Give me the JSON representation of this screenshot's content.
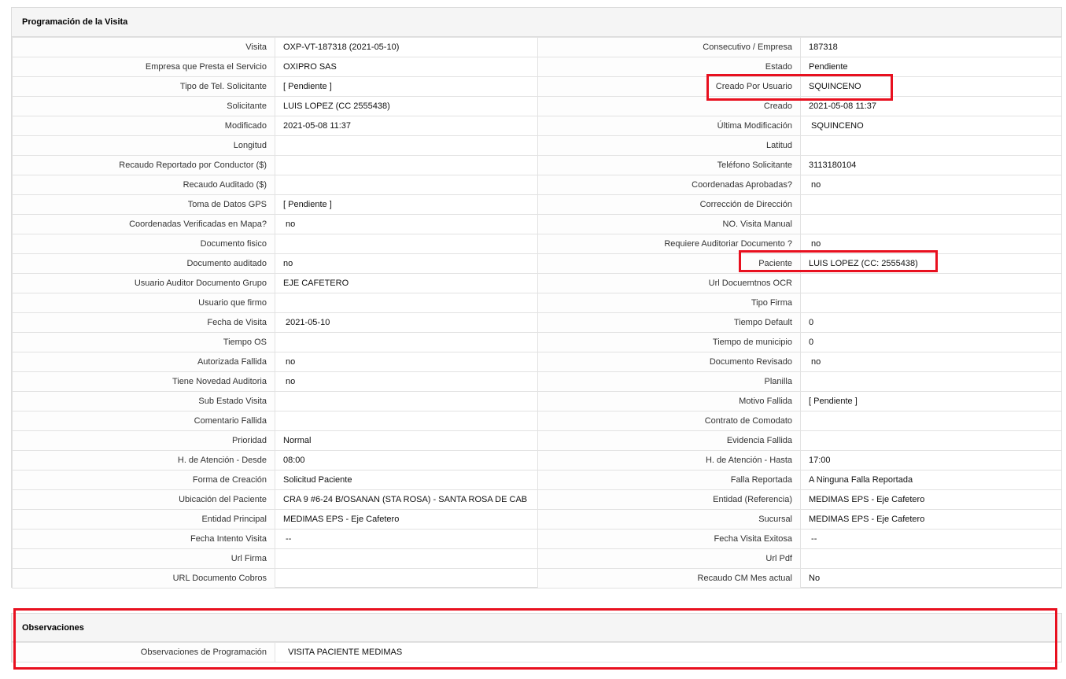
{
  "programacion": {
    "title": "Programación de la Visita",
    "rows": [
      [
        {
          "label": "Visita",
          "value": "OXP-VT-187318 (2021-05-10)"
        },
        {
          "label": "Consecutivo / Empresa",
          "value": "187318"
        }
      ],
      [
        {
          "label": "Empresa que Presta el Servicio",
          "value": "OXIPRO SAS"
        },
        {
          "label": "Estado",
          "value": "Pendiente"
        }
      ],
      [
        {
          "label": "Tipo de Tel. Solicitante",
          "value": "[ Pendiente ]"
        },
        {
          "label": "Creado Por Usuario",
          "value": "SQUINCENO"
        }
      ],
      [
        {
          "label": "Solicitante",
          "value": "LUIS LOPEZ (CC 2555438)"
        },
        {
          "label": "Creado",
          "value": "2021-05-08 11:37"
        }
      ],
      [
        {
          "label": "Modificado",
          "value": "2021-05-08 11:37"
        },
        {
          "label": "Última Modificación",
          "value": " SQUINCENO"
        }
      ],
      [
        {
          "label": "Longitud",
          "value": ""
        },
        {
          "label": "Latitud",
          "value": ""
        }
      ],
      [
        {
          "label": "Recaudo Reportado por Conductor ($)",
          "value": ""
        },
        {
          "label": "Teléfono Solicitante",
          "value": "3113180104"
        }
      ],
      [
        {
          "label": "Recaudo Auditado ($)",
          "value": ""
        },
        {
          "label": "Coordenadas Aprobadas?",
          "value": " no"
        }
      ],
      [
        {
          "label": "Toma de Datos GPS",
          "value": "[ Pendiente ]"
        },
        {
          "label": "Corrección de Dirección",
          "value": ""
        }
      ],
      [
        {
          "label": "Coordenadas Verificadas en Mapa?",
          "value": " no"
        },
        {
          "label": "NO. Visita Manual",
          "value": ""
        }
      ],
      [
        {
          "label": "Documento fisico",
          "value": ""
        },
        {
          "label": "Requiere Auditoriar Documento ?",
          "value": " no"
        }
      ],
      [
        {
          "label": "Documento auditado",
          "value": "no"
        },
        {
          "label": "Paciente",
          "value": "LUIS LOPEZ (CC: 2555438)"
        }
      ],
      [
        {
          "label": "Usuario Auditor Documento Grupo",
          "value": "EJE CAFETERO"
        },
        {
          "label": "Url Docuemtnos OCR",
          "value": ""
        }
      ],
      [
        {
          "label": "Usuario que firmo",
          "value": ""
        },
        {
          "label": "Tipo Firma",
          "value": ""
        }
      ],
      [
        {
          "label": "Fecha de Visita",
          "value": " 2021-05-10"
        },
        {
          "label": "Tiempo Default",
          "value": "0"
        }
      ],
      [
        {
          "label": "Tiempo OS",
          "value": ""
        },
        {
          "label": "Tiempo de municipio",
          "value": "0"
        }
      ],
      [
        {
          "label": "Autorizada Fallida",
          "value": " no"
        },
        {
          "label": "Documento Revisado",
          "value": " no"
        }
      ],
      [
        {
          "label": "Tiene Novedad Auditoria",
          "value": " no"
        },
        {
          "label": "Planilla",
          "value": ""
        }
      ],
      [
        {
          "label": "Sub Estado Visita",
          "value": ""
        },
        {
          "label": "Motivo Fallida",
          "value": "[ Pendiente ]"
        }
      ],
      [
        {
          "label": "Comentario Fallida",
          "value": ""
        },
        {
          "label": "Contrato de Comodato",
          "value": ""
        }
      ],
      [
        {
          "label": "Prioridad",
          "value": "Normal"
        },
        {
          "label": "Evidencia Fallida",
          "value": ""
        }
      ],
      [
        {
          "label": "H. de Atención - Desde",
          "value": "08:00"
        },
        {
          "label": "H. de Atención - Hasta",
          "value": "17:00"
        }
      ],
      [
        {
          "label": "Forma de Creación",
          "value": "Solicitud Paciente"
        },
        {
          "label": "Falla Reportada",
          "value": "A Ninguna Falla Reportada"
        }
      ],
      [
        {
          "label": "Ubicación del Paciente",
          "value": "CRA 9 #6-24 B/OSANAN (STA ROSA) - SANTA ROSA DE CAB"
        },
        {
          "label": "Entidad (Referencia)",
          "value": "MEDIMAS EPS - Eje Cafetero"
        }
      ],
      [
        {
          "label": "Entidad Principal",
          "value": "MEDIMAS EPS - Eje Cafetero"
        },
        {
          "label": "Sucursal",
          "value": "MEDIMAS EPS - Eje Cafetero"
        }
      ],
      [
        {
          "label": "Fecha Intento Visita",
          "value": " --"
        },
        {
          "label": "Fecha Visita Exitosa",
          "value": " --"
        }
      ],
      [
        {
          "label": "Url Firma",
          "value": ""
        },
        {
          "label": "Url Pdf",
          "value": ""
        }
      ],
      [
        {
          "label": "URL Documento Cobros",
          "value": ""
        },
        {
          "label": "Recaudo CM Mes actual",
          "value": "No"
        }
      ]
    ]
  },
  "observaciones": {
    "title": "Observaciones",
    "label": "Observaciones de Programación",
    "value": "  VISITA PACIENTE MEDIMAS"
  },
  "colors": {
    "highlight": "#e8101f",
    "header_bg": "#f5f5f5",
    "border": "#e2e2e2"
  }
}
